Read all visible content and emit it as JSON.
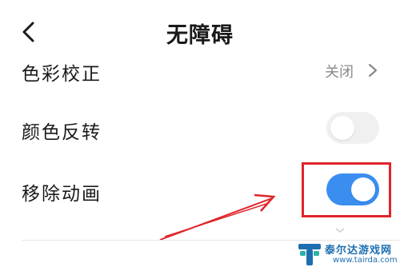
{
  "header": {
    "title": "无障碍",
    "back_icon": "chevron-left-icon"
  },
  "settings": [
    {
      "label": "色彩校正",
      "type": "link",
      "value": "关闭",
      "icon": "chevron-right-icon"
    },
    {
      "label": "颜色反转",
      "type": "toggle",
      "state": "off"
    },
    {
      "label": "移除动画",
      "type": "toggle",
      "state": "on"
    }
  ],
  "annotation": {
    "color": "#e0242a",
    "highlights": "移除动画 toggle"
  },
  "watermark": {
    "name": "泰尔达游戏网",
    "url": "www.tairda.com"
  },
  "colors": {
    "toggle_on": "#3a8ef0",
    "toggle_off": "#f0f0f0",
    "annotation": "#e0242a"
  }
}
